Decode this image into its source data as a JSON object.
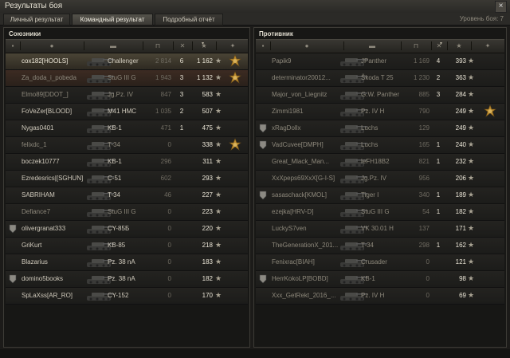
{
  "window": {
    "title": "Результаты боя",
    "close_label": "×"
  },
  "tabs": [
    {
      "label": "Личный результат",
      "active": false
    },
    {
      "label": "Командный результат",
      "active": true
    },
    {
      "label": "Подробный отчёт",
      "active": false
    }
  ],
  "battle_level": "Уровень боя: 7",
  "allies": {
    "title": "Союзники",
    "rows": [
      {
        "name": "cox182[HOOLS]",
        "vehicle": "Challenger",
        "damage": "2 814",
        "kills": "6",
        "xp": "1 162",
        "medal": true,
        "state": "me"
      },
      {
        "name": "Za_doda_i_pobeda",
        "vehicle": "StuG III G",
        "damage": "1 943",
        "kills": "3",
        "xp": "1 132",
        "medal": true,
        "state": "dead-hl"
      },
      {
        "name": "Elmo89[DDOT_]",
        "vehicle": "Jg.Pz. IV",
        "damage": "847",
        "kills": "3",
        "xp": "583",
        "medal": false,
        "state": "dead"
      },
      {
        "name": "FoVeZer[BLOOD]",
        "vehicle": "M41 HMC",
        "damage": "1 035",
        "kills": "2",
        "xp": "507",
        "medal": false,
        "state": "alive"
      },
      {
        "name": "Nygas0401",
        "vehicle": "KB-1",
        "damage": "471",
        "kills": "1",
        "xp": "475",
        "medal": false,
        "state": "alive"
      },
      {
        "name": "felixdc_1",
        "vehicle": "T-34",
        "damage": "0",
        "kills": "",
        "xp": "338",
        "medal": true,
        "state": "dead"
      },
      {
        "name": "boczek10777",
        "vehicle": "KB-1",
        "damage": "296",
        "kills": "",
        "xp": "311",
        "medal": false,
        "state": "alive"
      },
      {
        "name": "Ezredesrics|[SGHUN]",
        "vehicle": "C-51",
        "damage": "602",
        "kills": "",
        "xp": "293",
        "medal": false,
        "state": "alive"
      },
      {
        "name": "SABRIHAM",
        "vehicle": "T-34",
        "damage": "46",
        "kills": "",
        "xp": "227",
        "medal": false,
        "state": "alive"
      },
      {
        "name": "Defiance7",
        "vehicle": "StuG III G",
        "damage": "0",
        "kills": "",
        "xp": "223",
        "medal": false,
        "state": "dead"
      },
      {
        "name": "olivergranat333",
        "vehicle": "CY-85Б",
        "damage": "0",
        "kills": "",
        "xp": "220",
        "medal": false,
        "state": "alive",
        "platoon": true
      },
      {
        "name": "GriKurt",
        "vehicle": "KB-85",
        "damage": "0",
        "kills": "",
        "xp": "218",
        "medal": false,
        "state": "alive"
      },
      {
        "name": "Blazarius",
        "vehicle": "Pz. 38 nA",
        "damage": "0",
        "kills": "",
        "xp": "183",
        "medal": false,
        "state": "alive"
      },
      {
        "name": "domino5books",
        "vehicle": "Pz. 38 nA",
        "damage": "0",
        "kills": "",
        "xp": "182",
        "medal": false,
        "state": "alive",
        "platoon": true
      },
      {
        "name": "SpLaXss[AR_RO]",
        "vehicle": "CY-152",
        "damage": "0",
        "kills": "",
        "xp": "170",
        "medal": false,
        "state": "alive"
      }
    ]
  },
  "enemies": {
    "title": "Противник",
    "rows": [
      {
        "name": "Papik9",
        "vehicle": "JPanther",
        "damage": "1 169",
        "kills": "4",
        "xp": "393",
        "medal": false,
        "state": "dead"
      },
      {
        "name": "determinator20012...",
        "vehicle": "Škoda T 25",
        "damage": "1 230",
        "kills": "2",
        "xp": "363",
        "medal": false,
        "state": "dead"
      },
      {
        "name": "Major_von_Liegnitz",
        "vehicle": "G.W. Panther",
        "damage": "885",
        "kills": "3",
        "xp": "284",
        "medal": false,
        "state": "dead"
      },
      {
        "name": "Zimmi1981",
        "vehicle": "Pz. IV H",
        "damage": "790",
        "kills": "",
        "xp": "249",
        "medal": true,
        "state": "dead"
      },
      {
        "name": "xRagDollx",
        "vehicle": "Luchs",
        "damage": "129",
        "kills": "",
        "xp": "249",
        "medal": false,
        "state": "dead",
        "platoon": true
      },
      {
        "name": "VadCuvee[DMPH]",
        "vehicle": "Luchs",
        "damage": "165",
        "kills": "1",
        "xp": "240",
        "medal": false,
        "state": "dead",
        "platoon": true
      },
      {
        "name": "Great_Mlack_Man...",
        "vehicle": "leFH18B2",
        "damage": "821",
        "kills": "1",
        "xp": "232",
        "medal": false,
        "state": "dead"
      },
      {
        "name": "XxXpeps69XxX[G-I-S]",
        "vehicle": "Jg.Pz. IV",
        "damage": "956",
        "kills": "",
        "xp": "206",
        "medal": false,
        "state": "dead"
      },
      {
        "name": "sasaschack[KMOL]",
        "vehicle": "Tiger I",
        "damage": "340",
        "kills": "1",
        "xp": "189",
        "medal": false,
        "state": "dead",
        "platoon": true
      },
      {
        "name": "ezejka[HRV-D]",
        "vehicle": "StuG III G",
        "damage": "54",
        "kills": "1",
        "xp": "182",
        "medal": false,
        "state": "dead"
      },
      {
        "name": "LuckyS7ven",
        "vehicle": "VK 30.01 H",
        "damage": "137",
        "kills": "",
        "xp": "171",
        "medal": false,
        "state": "dead"
      },
      {
        "name": "TheGenerationX_201...",
        "vehicle": "T-34",
        "damage": "298",
        "kills": "1",
        "xp": "162",
        "medal": false,
        "state": "dead"
      },
      {
        "name": "Fenixrac[BIAH]",
        "vehicle": "Crusader",
        "damage": "0",
        "kills": "",
        "xp": "121",
        "medal": false,
        "state": "dead"
      },
      {
        "name": "HerrKokoLP[BOBD]",
        "vehicle": "KB-1",
        "damage": "0",
        "kills": "",
        "xp": "98",
        "medal": false,
        "state": "dead",
        "platoon": true
      },
      {
        "name": "Xxx_GetRekt_2016_...",
        "vehicle": "Pz. IV H",
        "damage": "0",
        "kills": "",
        "xp": "69",
        "medal": false,
        "state": "dead"
      }
    ]
  },
  "colors": {
    "highlight_row": "#3c2b22",
    "self_row": "#4a4436",
    "text_dim": "#8d887b"
  }
}
